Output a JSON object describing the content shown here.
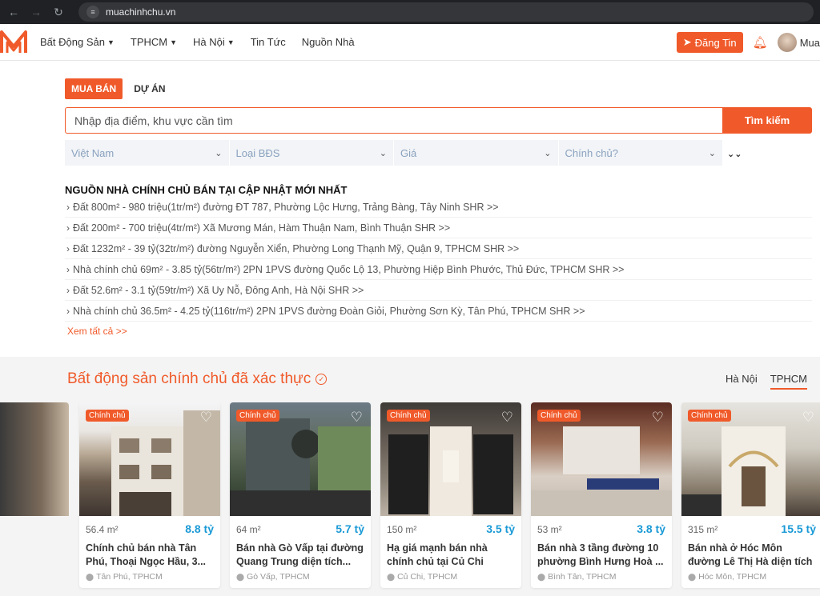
{
  "browser": {
    "url": "muachinhchu.vn"
  },
  "header": {
    "menu": [
      {
        "label": "Bất Động Sản",
        "has_caret": true
      },
      {
        "label": "TPHCM",
        "has_caret": true
      },
      {
        "label": "Hà Nội",
        "has_caret": true
      },
      {
        "label": "Tin Tức",
        "has_caret": false
      },
      {
        "label": "Nguồn Nhà",
        "has_caret": false
      }
    ],
    "post_button": "Đăng Tin",
    "user_label": "Mua",
    "brand_color": "#f05a2a"
  },
  "search": {
    "tabs": [
      "MUA BÁN",
      "DỰ ÁN"
    ],
    "active_tab": "MUA BÁN",
    "placeholder": "Nhập địa điểm, khu vực cần tìm",
    "button": "Tìm kiếm",
    "filters": [
      "Việt Nam",
      "Loại BĐS",
      "Giá",
      "Chính chủ?"
    ]
  },
  "latest": {
    "title": "NGUỒN NHÀ CHÍNH CHỦ BÁN TẠI CẬP NHẬT MỚI NHẤT",
    "items": [
      "Đất 800m² - 980 triệu(1tr/m²) đường ĐT 787, Phường Lộc Hưng, Trảng Bàng, Tây Ninh SHR >>",
      "Đất 200m² - 700 triệu(4tr/m²) Xã Mương Mán, Hàm Thuận Nam, Bình Thuận SHR >>",
      "Đất 1232m² - 39 tỷ(32tr/m²) đường Nguyễn Xiển, Phường Long Thạnh Mỹ, Quận 9, TPHCM SHR >>",
      "Nhà chính chủ 69m² - 3.85 tỷ(56tr/m²) 2PN 1PVS đường Quốc Lộ 13, Phường Hiệp Bình Phước, Thủ Đức, TPHCM SHR >>",
      "Đất 52.6m² - 3.1 tỷ(59tr/m²) Xã Uy Nỗ, Đông Anh, Hà Nội SHR >>",
      "Nhà chính chủ 36.5m² - 4.25 tỷ(116tr/m²) 2PN 1PVS đường Đoàn Giỏi, Phường Sơn Kỳ, Tân Phú, TPHCM SHR >>"
    ],
    "see_all": "Xem tất cả >>"
  },
  "verified": {
    "title": "Bất động sản chính chủ đã xác thực",
    "city_tabs": [
      "Hà Nội",
      "TPHCM"
    ],
    "active_city": "TPHCM",
    "badge": "Chính chủ",
    "cards": [
      {
        "area": "56.4 m²",
        "price": "8.8 tỷ",
        "title": "Chính chủ bán nhà Tân Phú, Thoại Ngọc Hầu, 3...",
        "location": "Tân Phú, TPHCM"
      },
      {
        "area": "64 m²",
        "price": "5.7 tỷ",
        "title": "Bán nhà Gò Vấp tại đường Quang Trung diện tích...",
        "location": "Gò Vấp, TPHCM"
      },
      {
        "area": "150 m²",
        "price": "3.5 tỷ",
        "title": "Hạ giá mạnh bán nhà chính chủ tại Củ Chi đườ...",
        "location": "Củ Chi, TPHCM"
      },
      {
        "area": "53 m²",
        "price": "3.8 tỷ",
        "title": "Bán nhà 3 tầng đường 10 phường Bình Hưng Hoà ...",
        "location": "Bình Tân, TPHCM"
      },
      {
        "area": "315 m²",
        "price": "15.5 tỷ",
        "title": "Bán nhà ở Hóc Môn đường Lê Thị Hà diện tích lớn...",
        "location": "Hóc Môn, TPHCM"
      }
    ]
  }
}
